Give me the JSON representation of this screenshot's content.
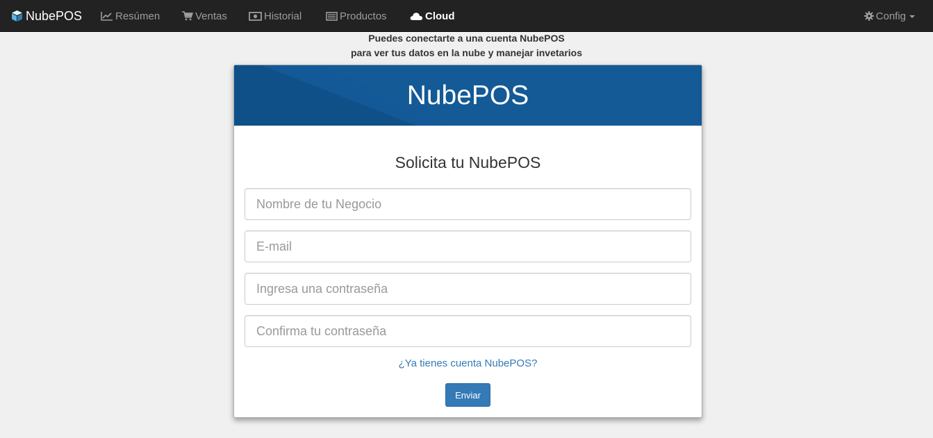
{
  "navbar": {
    "brand": "NubePOS",
    "items": [
      {
        "label": "Resúmen",
        "icon": "chart-line-icon"
      },
      {
        "label": "Ventas",
        "icon": "shopping-cart-icon"
      },
      {
        "label": "Historial",
        "icon": "money-icon"
      },
      {
        "label": "Productos",
        "icon": "list-icon"
      },
      {
        "label": "Cloud",
        "icon": "cloud-icon",
        "active": true
      }
    ],
    "config": {
      "label": "Config",
      "icon": "gear-icon"
    }
  },
  "intro": {
    "line1": "Puedes conectarte a una cuenta NubePOS",
    "line2": "para ver tus datos en la nube y manejar invetarios"
  },
  "card": {
    "header_title": "NubePOS",
    "form_title": "Solicita tu NubePOS",
    "fields": {
      "business_placeholder": "Nombre de tu Negocio",
      "email_placeholder": "E-mail",
      "password_placeholder": "Ingresa una contraseña",
      "confirm_placeholder": "Confirma tu contraseña"
    },
    "login_link": "¿Ya tienes cuenta NubePOS?",
    "submit_label": "Enviar"
  },
  "colors": {
    "navbar_bg": "#222222",
    "header_blue": "#135a96",
    "primary": "#337ab7"
  }
}
